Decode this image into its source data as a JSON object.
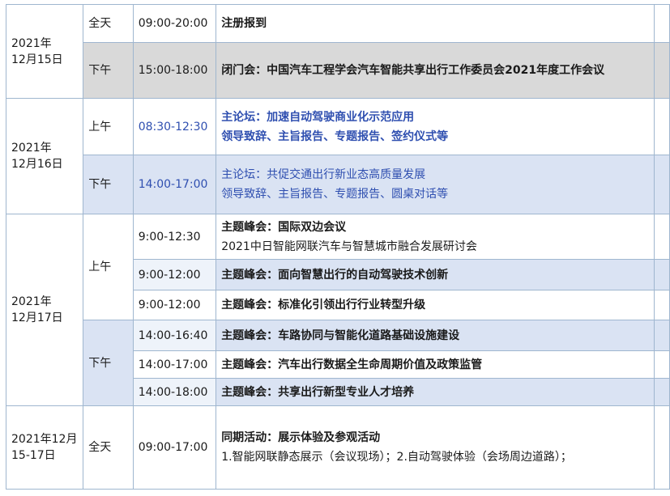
{
  "schedule": {
    "day1": {
      "date": "2021年\n12月15日",
      "rows": [
        {
          "period": "全天",
          "time": "09:00-20:00",
          "title": "注册报到"
        },
        {
          "period": "下午",
          "time": "15:00-18:00",
          "title": "闭门会：中国汽车工程学会汽车智能共享出行工作委员会2021年度工作会议"
        }
      ]
    },
    "day2": {
      "date": "2021年\n12月16日",
      "rows": [
        {
          "period": "上午",
          "time": "08:30-12:30",
          "title": "主论坛：加速自动驾驶商业化示范应用",
          "sub": "领导致辞、主旨报告、专题报告、签约仪式等"
        },
        {
          "period": "下午",
          "time": "14:00-17:00",
          "title": "主论坛：共促交通出行新业态高质量发展",
          "sub": "领导致辞、主旨报告、专题报告、圆桌对话等"
        }
      ]
    },
    "day3": {
      "date": "2021年\n12月17日",
      "am_label": "上午",
      "pm_label": "下午",
      "rows": [
        {
          "time": "9:00-12:30",
          "title": "主题峰会：国际双边会议",
          "sub": "2021中日智能网联汽车与智慧城市融合发展研讨会"
        },
        {
          "time": "9:00-12:00",
          "title": "主题峰会：面向智慧出行的自动驾驶技术创新"
        },
        {
          "time": "9:00-12:00",
          "title": "主题峰会：标准化引领出行行业转型升级"
        },
        {
          "time": "14:00-16:40",
          "title": "主题峰会：车路协同与智能化道路基础设施建设"
        },
        {
          "time": "14:00-17:00",
          "title": "主题峰会：汽车出行数据全生命周期价值及政策监管"
        },
        {
          "time": "14:00-18:00",
          "title": "主题峰会：共享出行新型专业人才培养"
        }
      ]
    },
    "day4": {
      "date": "2021年12月\n15-17日",
      "period": "全天",
      "time": "09:00-17:00",
      "title": "同期活动：展示体验及参观活动",
      "sub": "1.智能网联静态展示（会议现场）；2.自动驾驶体验（会场周边道路）；"
    }
  },
  "colors": {
    "border": "#9fb6cf",
    "gray_row": "#d9d9d9",
    "blue_row": "#dae3f3",
    "stripe_row": "#eef3fa",
    "link_blue": "#2f4fb0"
  }
}
